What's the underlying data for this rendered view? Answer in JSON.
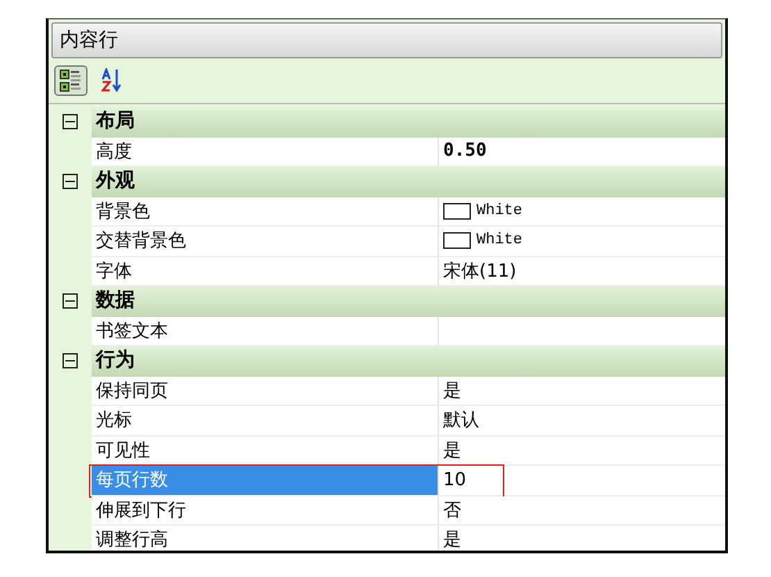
{
  "title": "内容行",
  "toolbar": [
    {
      "kind": "categorized",
      "selected": true
    },
    {
      "kind": "alphabetical",
      "selected": false
    }
  ],
  "categories": [
    {
      "name": "布局",
      "expanded": true,
      "items": [
        {
          "name": "高度",
          "value": "0.50",
          "kind": "number",
          "selected": false
        }
      ]
    },
    {
      "name": "外观",
      "expanded": true,
      "items": [
        {
          "name": "背景色",
          "value": "White",
          "kind": "color",
          "color": "#ffffff",
          "selected": false
        },
        {
          "name": "交替背景色",
          "value": "White",
          "kind": "color",
          "color": "#ffffff",
          "selected": false
        },
        {
          "name": "字体",
          "value": "宋体(11)",
          "kind": "text",
          "selected": false
        }
      ]
    },
    {
      "name": "数据",
      "expanded": true,
      "items": [
        {
          "name": "书签文本",
          "value": "",
          "kind": "text",
          "selected": false
        }
      ]
    },
    {
      "name": "行为",
      "expanded": true,
      "items": [
        {
          "name": "保持同页",
          "value": "是",
          "kind": "text",
          "selected": false
        },
        {
          "name": "光标",
          "value": "默认",
          "kind": "text",
          "selected": false
        },
        {
          "name": "可见性",
          "value": "是",
          "kind": "text",
          "selected": false
        },
        {
          "name": "每页行数",
          "value": "10",
          "kind": "text",
          "selected": true
        },
        {
          "name": "伸展到下行",
          "value": "否",
          "kind": "text",
          "selected": false
        },
        {
          "name": "调整行高",
          "value": "是",
          "kind": "text",
          "selected": false
        }
      ]
    }
  ]
}
